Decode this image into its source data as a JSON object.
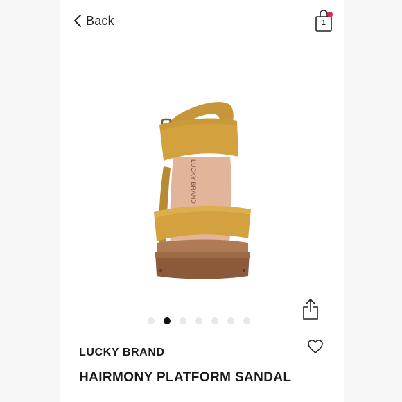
{
  "nav": {
    "back_label": "Back",
    "back_icon": "chevron-left-icon",
    "cart_icon": "shopping-bag-icon",
    "cart_count": "1",
    "cart_badge_color": "#e3264a"
  },
  "product": {
    "brand": "LUCKY BRAND",
    "name": "HAIRMONY PLATFORM SANDAL",
    "insole_text": "LUCKY BRAND",
    "image_icon": "sandal-photo"
  },
  "carousel": {
    "total": 7,
    "active_index": 1
  },
  "actions": {
    "share_icon": "share-icon",
    "favorite_icon": "heart-icon"
  },
  "colors": {
    "suede": "#d3a23f",
    "wood": "#8a5a3a",
    "footbed": "#e2b49a"
  }
}
